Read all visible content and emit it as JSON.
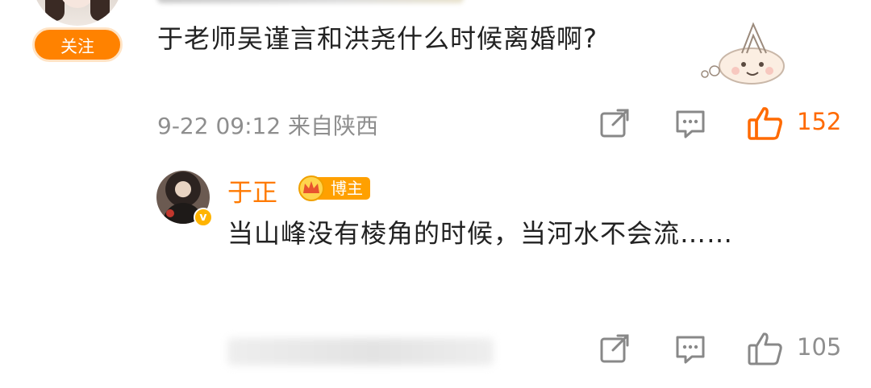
{
  "top_comment": {
    "follow_label": "关注",
    "text": "于老师吴谨言和洪尧什么时候离婚啊?",
    "meta": "9-22 09:12 来自陕西",
    "like_count": "152"
  },
  "reply": {
    "username": "于正",
    "badge": "博主",
    "text": "当山峰没有棱角的时候，当河水不会流……",
    "verified_mark": "v",
    "like_count": "105"
  },
  "colors": {
    "accent": "#ff8200",
    "liked": "#ff6a00",
    "meta_gray": "#8e8e8e"
  },
  "icons": [
    "share-icon",
    "comment-icon",
    "like-icon"
  ]
}
